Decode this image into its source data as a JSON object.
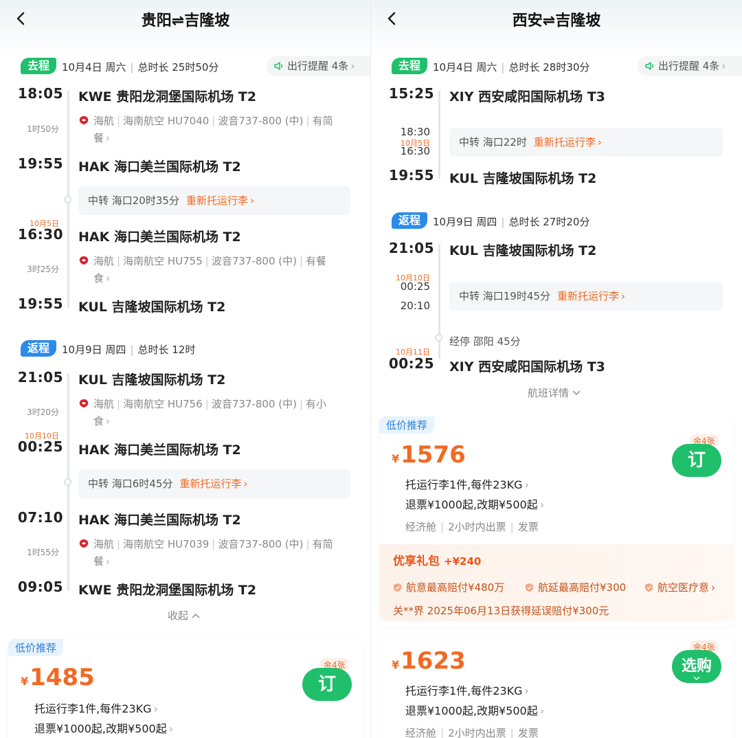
{
  "left": {
    "title": "贵阳⇌吉隆坡",
    "out": {
      "badge": "去程",
      "date": "10月4日 周六",
      "duration": "总时长 25时50分",
      "reminder": "出行提醒 4条",
      "seg1": {
        "dep_time": "18:05",
        "dep_airport": "KWE 贵阳龙洞堡国际机场 T2",
        "dur": "1时50分",
        "flight_l1": "海航",
        "flight_l2": "海南航空 HU7040",
        "flight_l3": "波音737-800 (中)",
        "flight_l4": "有简",
        "flight_l5": "餐",
        "arr_time": "19:55",
        "arr_airport": "HAK 海口美兰国际机场 T2"
      },
      "transfer": {
        "text": "中转 海口20时35分",
        "action": "重新托运行李"
      },
      "seg2": {
        "date_tag": "10月5日",
        "dep_time": "16:30",
        "dep_airport": "HAK 海口美兰国际机场 T2",
        "dur": "3时25分",
        "flight_l1": "海航",
        "flight_l2": "海南航空 HU755",
        "flight_l3": "波音737-800 (中)",
        "flight_l4": "有餐",
        "flight_l5": "食",
        "arr_time": "19:55",
        "arr_airport": "KUL 吉隆坡国际机场 T2"
      }
    },
    "ret": {
      "badge": "返程",
      "date": "10月9日 周四",
      "duration": "总时长 12时",
      "seg1": {
        "dep_time": "21:05",
        "dep_airport": "KUL 吉隆坡国际机场 T2",
        "dur": "3时20分",
        "flight_l1": "海航",
        "flight_l2": "海南航空 HU756",
        "flight_l3": "波音737-800 (中)",
        "flight_l4": "有小",
        "flight_l5": "食",
        "date_tag": "10月10日",
        "arr_time": "00:25",
        "arr_airport": "HAK 海口美兰国际机场 T2"
      },
      "transfer": {
        "text": "中转 海口6时45分",
        "action": "重新托运行李"
      },
      "seg2": {
        "dep_time": "07:10",
        "dep_airport": "HAK 海口美兰国际机场 T2",
        "dur": "1时55分",
        "flight_l1": "海航",
        "flight_l2": "海南航空 HU7039",
        "flight_l3": "波音737-800 (中)",
        "flight_l4": "有简",
        "flight_l5": "餐",
        "arr_time": "09:05",
        "arr_airport": "KWE 贵阳龙洞堡国际机场 T2"
      }
    },
    "collapse": "收起",
    "offer": {
      "tag": "低价推荐",
      "currency": "¥",
      "price": "1485",
      "remain": "余4张",
      "button": "订",
      "baggage": "托运行李1件,每件23KG",
      "refund": "退票¥1000起,改期¥500起"
    }
  },
  "right": {
    "title": "西安⇌吉隆坡",
    "out": {
      "badge": "去程",
      "date": "10月4日 周六",
      "duration": "总时长 28时30分",
      "reminder": "出行提醒 4条",
      "dep_time": "15:25",
      "dep_airport": "XIY 西安咸阳国际机场 T3",
      "transfer_arr": "18:30",
      "transfer_date": "10月5日",
      "transfer_dep": "16:30",
      "transfer": {
        "text": "中转 海口22时",
        "action": "重新托运行李"
      },
      "arr_time": "19:55",
      "arr_airport": "KUL 吉隆坡国际机场 T2"
    },
    "ret": {
      "badge": "返程",
      "date": "10月9日 周四",
      "duration": "总时长 27时20分",
      "dep_time": "21:05",
      "dep_airport": "KUL 吉隆坡国际机场 T2",
      "transfer_date": "10月10日",
      "transfer_arr": "00:25",
      "transfer_dep": "20:10",
      "transfer": {
        "text": "中转 海口19时45分",
        "action": "重新托运行李"
      },
      "stop": "经停 邵阳 45分",
      "arr_date": "10月11日",
      "arr_time": "00:25",
      "arr_airport": "XIY 西安咸阳国际机场 T3"
    },
    "details": "航班详情",
    "offer1": {
      "tag": "低价推荐",
      "currency": "¥",
      "price": "1576",
      "remain": "余4张",
      "button": "订",
      "baggage": "托运行李1件,每件23KG",
      "refund": "退票¥1000起,改期¥500起",
      "cabin": "经济舱",
      "issue": "2小时内出票",
      "invoice": "发票",
      "gift_title": "优享礼包",
      "gift_plus": "+¥240",
      "benefit1": "航意最高赔付¥480万",
      "benefit2": "航延最高赔付¥300",
      "benefit3": "航空医疗意",
      "claim": "关**界 2025年06月13日获得延误赔付¥300元"
    },
    "offer2": {
      "currency": "¥",
      "price": "1623",
      "remain": "余4张",
      "button": "选购",
      "baggage": "托运行李1件,每件23KG",
      "refund": "退票¥1000起,改期¥500起",
      "cabin": "经济舱",
      "issue": "2小时内出票",
      "invoice": "发票"
    }
  },
  "colors": {
    "green": "#1fbf6b",
    "blue": "#2c8be8",
    "orange": "#f06a24"
  },
  "icons": [
    "back-arrow-icon",
    "speaker-icon",
    "hainan-airlines-logo-icon",
    "shield-icon",
    "chevron-right-icon",
    "chevron-up-icon",
    "chevron-down-icon"
  ]
}
